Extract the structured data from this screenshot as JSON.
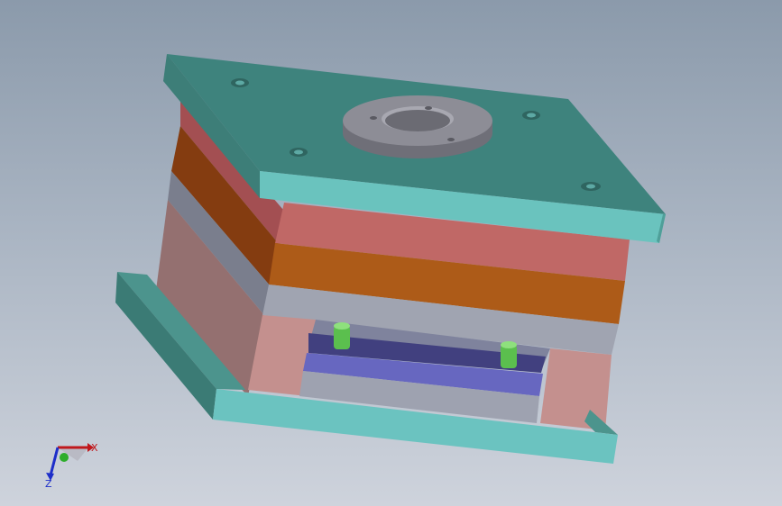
{
  "viewport": {
    "background_top": "#8b9aab",
    "background_bottom": "#ced3dc"
  },
  "model": {
    "colors": {
      "top_clamp_plate": "#3e837d",
      "top_clamp_plate_edge": "#6ac3be",
      "cavity_plate": "#c06866",
      "core_plate": "#ad5b18",
      "support_plate": "#a0a4b1",
      "spacer_block": "#c4908e",
      "ejector_retainer_plate": "#41407f",
      "ejector_plate": "#6767c0",
      "bottom_clamp_plate": "#4c948d",
      "bottom_clamp_plate_edge": "#6bc3c0",
      "locating_ring": "#8d8d96",
      "guide_pin": "#5bbf4e"
    }
  },
  "triad": {
    "x_label": "X",
    "z_label": "Z",
    "x_color": "#c0181c",
    "y_color": "#2dad2b",
    "z_color": "#1d2ec9"
  }
}
